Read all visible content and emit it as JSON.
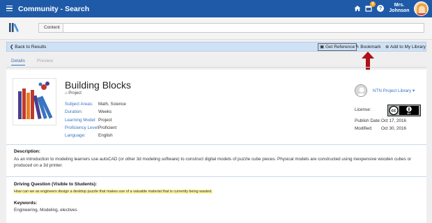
{
  "app": {
    "title": "Community - Search",
    "notification_count": "0",
    "help_label": "?",
    "user_name_line1": "Mrs.",
    "user_name_line2": "Johnson"
  },
  "search": {
    "field_label": "Content",
    "value": ""
  },
  "actions": {
    "back": "Back to Results",
    "get_reference": "Get Reference",
    "bookmark": "Bookmark",
    "add_to_library": "Add to My Library"
  },
  "tabs": [
    "Details",
    "Preview"
  ],
  "resource": {
    "title": "Building Blocks",
    "type": "Project",
    "meta": [
      {
        "key": "Subject Areas:",
        "value": "Math, Science"
      },
      {
        "key": "Duration:",
        "value": "Weeks"
      },
      {
        "key": "Learning Model:",
        "value": "Project"
      },
      {
        "key": "Proficiency Level:",
        "value": "Proficient"
      },
      {
        "key": "Language:",
        "value": "English"
      }
    ]
  },
  "side": {
    "library": "NTN Project Library",
    "license_label": "License:",
    "cc_text": "BY",
    "publish_label": "Publish Date:",
    "publish_value": "Oct 17, 2016",
    "modified_label": "Modified:",
    "modified_value": "Oct 30, 2016"
  },
  "description": {
    "heading": "Description:",
    "text": "As an introduction to modeling learners use autoCAD (or other 3d modeling software) to construct digital models of puzzle cube pieces. Physical models are constructed using inexpensive wooden cubes or produced on a 3d printer."
  },
  "driving_question": {
    "heading": "Driving Question (Visible to Students):",
    "text": "How can we as engineers design a desktop puzzle that makes use of a valuable material that is currently being wasted."
  },
  "keywords": {
    "heading": "Keywords:",
    "text": "Engineering, Modeling, electives"
  },
  "colors": {
    "header_blue": "#1f5aa8",
    "link_blue": "#3a74c0",
    "action_bar": "#cfe1f5",
    "arrow_red": "#b0101a",
    "highlight": "#fff6a6"
  }
}
